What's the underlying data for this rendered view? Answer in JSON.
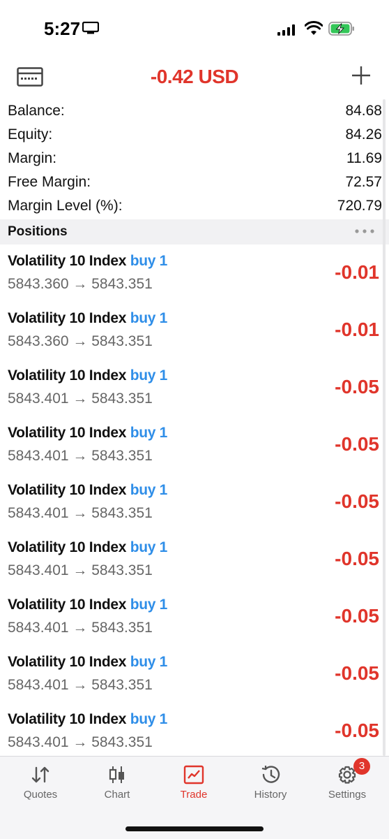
{
  "status_bar": {
    "time": "5:27"
  },
  "header": {
    "total_profit": "-0.42 USD"
  },
  "summary": [
    {
      "label": "Balance:",
      "value": "84.68"
    },
    {
      "label": "Equity:",
      "value": "84.26"
    },
    {
      "label": "Margin:",
      "value": "11.69"
    },
    {
      "label": "Free Margin:",
      "value": "72.57"
    },
    {
      "label": "Margin Level (%):",
      "value": "720.79"
    }
  ],
  "positions_section": {
    "title": "Positions"
  },
  "positions": [
    {
      "symbol": "Volatility 10 Index",
      "type": "buy 1",
      "prices": "5843.360 → 5843.351",
      "profit": "-0.01"
    },
    {
      "symbol": "Volatility 10 Index",
      "type": "buy 1",
      "prices": "5843.360 → 5843.351",
      "profit": "-0.01"
    },
    {
      "symbol": "Volatility 10 Index",
      "type": "buy 1",
      "prices": "5843.401 → 5843.351",
      "profit": "-0.05"
    },
    {
      "symbol": "Volatility 10 Index",
      "type": "buy 1",
      "prices": "5843.401 → 5843.351",
      "profit": "-0.05"
    },
    {
      "symbol": "Volatility 10 Index",
      "type": "buy 1",
      "prices": "5843.401 → 5843.351",
      "profit": "-0.05"
    },
    {
      "symbol": "Volatility 10 Index",
      "type": "buy 1",
      "prices": "5843.401 → 5843.351",
      "profit": "-0.05"
    },
    {
      "symbol": "Volatility 10 Index",
      "type": "buy 1",
      "prices": "5843.401 → 5843.351",
      "profit": "-0.05"
    },
    {
      "symbol": "Volatility 10 Index",
      "type": "buy 1",
      "prices": "5843.401 → 5843.351",
      "profit": "-0.05"
    },
    {
      "symbol": "Volatility 10 Index",
      "type": "buy 1",
      "prices": "5843.401 → 5843.351",
      "profit": "-0.05"
    }
  ],
  "tabs": [
    {
      "label": "Quotes",
      "icon": "quotes-icon"
    },
    {
      "label": "Chart",
      "icon": "chart-icon"
    },
    {
      "label": "Trade",
      "icon": "trade-icon",
      "active": true
    },
    {
      "label": "History",
      "icon": "history-icon"
    },
    {
      "label": "Settings",
      "icon": "gear-icon",
      "badge": "3"
    }
  ],
  "colors": {
    "loss": "#e0352b",
    "buy": "#2f8ee8",
    "active_tab": "#e0352b"
  }
}
